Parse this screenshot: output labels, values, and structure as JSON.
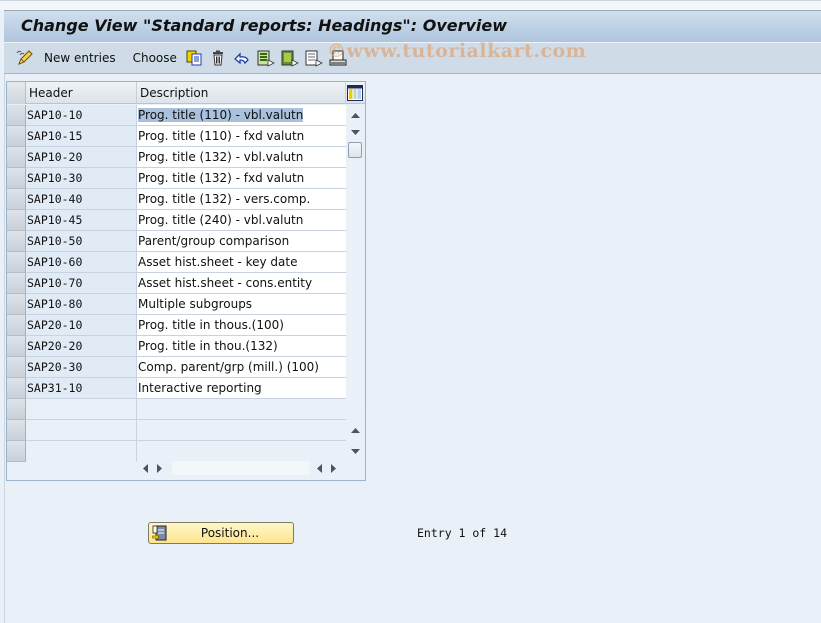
{
  "window": {
    "title": "Change View \"Standard reports: Headings\": Overview"
  },
  "toolbar": {
    "items": [
      {
        "type": "button",
        "icon": "edit-pencil-icon",
        "label": ""
      },
      {
        "type": "button",
        "icon": "",
        "label": "New entries"
      },
      {
        "type": "button",
        "icon": "",
        "label": "Choose"
      },
      {
        "type": "icon",
        "icon": "copy-as-icon"
      },
      {
        "type": "icon",
        "icon": "delete-trash-icon"
      },
      {
        "type": "icon",
        "icon": "undo-change-icon"
      },
      {
        "type": "icon",
        "icon": "select-all-icon"
      },
      {
        "type": "icon",
        "icon": "select-block-icon"
      },
      {
        "type": "icon",
        "icon": "deselect-all-icon"
      },
      {
        "type": "icon",
        "icon": "print-icon"
      }
    ],
    "new_entries_label": "New entries",
    "choose_label": "Choose"
  },
  "watermark": "©www.tutorialkart.com",
  "table": {
    "columns": [
      "Header",
      "Description"
    ],
    "rows": [
      {
        "header": "SAP10-10",
        "description": "Prog. title (110) - vbl.valutn",
        "highlighted": true
      },
      {
        "header": "SAP10-15",
        "description": "Prog. title (110) - fxd valutn"
      },
      {
        "header": "SAP10-20",
        "description": "Prog. title (132) - vbl.valutn"
      },
      {
        "header": "SAP10-30",
        "description": "Prog. title (132) - fxd valutn"
      },
      {
        "header": "SAP10-40",
        "description": "Prog. title (132) - vers.comp."
      },
      {
        "header": "SAP10-45",
        "description": "Prog. title (240) - vbl.valutn"
      },
      {
        "header": "SAP10-50",
        "description": "Parent/group comparison"
      },
      {
        "header": "SAP10-60",
        "description": "Asset hist.sheet - key date"
      },
      {
        "header": "SAP10-70",
        "description": "Asset hist.sheet - cons.entity"
      },
      {
        "header": "SAP10-80",
        "description": "Multiple subgroups"
      },
      {
        "header": "SAP20-10",
        "description": "Prog. title in thous.(100)"
      },
      {
        "header": "SAP20-20",
        "description": "Prog. title in thou.(132)"
      },
      {
        "header": "SAP20-30",
        "description": "Comp. parent/grp (mill.) (100)"
      },
      {
        "header": "SAP31-10",
        "description": "Interactive reporting"
      }
    ],
    "empty_rows": 3
  },
  "footer": {
    "position_button_label": "Position...",
    "entry_text": "Entry 1 of 14"
  },
  "colors": {
    "title_gradient_top": "#d0dfed",
    "title_gradient_bottom": "#aec5de",
    "toolbar_bg": "#cfdce7",
    "page_bg": "#e9f0f7",
    "key_column_bg": "#e1ebf5",
    "selection_highlight": "#a9c1dc",
    "position_button_bg": "#fde58f"
  }
}
